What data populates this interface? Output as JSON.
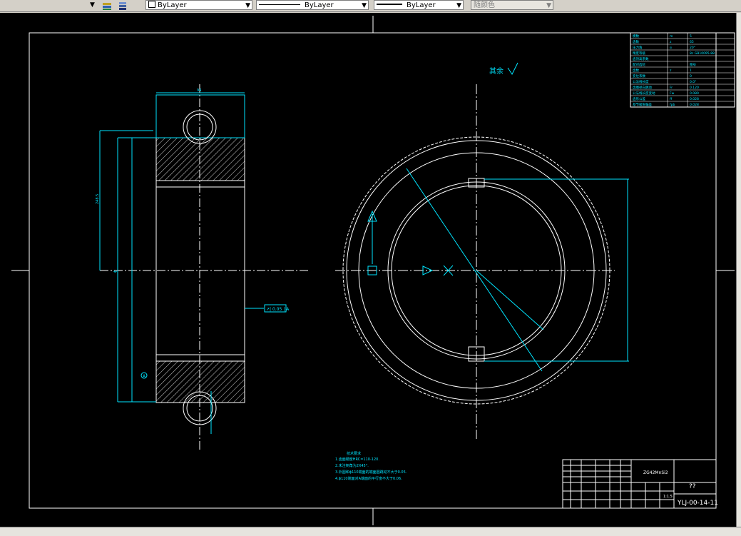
{
  "toolbar": {
    "linetype_value": "ByLayer",
    "lineweight_value": "ByLayer",
    "lineweight2_value": "ByLayer",
    "color_value": "随颜色"
  },
  "drawing": {
    "surface_mark_text": "其余",
    "tech_req_title": "技术要求",
    "tech_req_lines": [
      "1.齿面硬度HRC=110-120.",
      "2.未注倒角为2X45°.",
      "3.外圆和ϕ110端面的端面圆跳动不大于0.05.",
      "4.ϕ110端面对A端面的平行度不大于0.06."
    ],
    "title_material": "ZG42MnSi2",
    "title_name": "??",
    "title_scale": "1:1.5",
    "drawing_number": "YLJ-00-14-11",
    "datum_label": "A",
    "runout_frame": "↗| 0.05 | A",
    "gear_table": [
      [
        "模数",
        "m",
        "5"
      ],
      [
        "齿数",
        "z",
        "65"
      ],
      [
        "压力角",
        "α",
        "20°"
      ],
      [
        "精度等级",
        "",
        "8c GB10095-88"
      ],
      [
        "齿顶高系数",
        "",
        ""
      ],
      [
        "配对齿轮",
        "",
        "图号"
      ],
      [
        "齿数",
        "z",
        "1"
      ],
      [
        "变位系数",
        "",
        "0"
      ],
      [
        "公法线长度",
        "",
        "0.0°"
      ],
      [
        "齿圈径向跳动",
        "Fr",
        "0.120"
      ],
      [
        "公法线长度变动",
        "Fw",
        "0.080"
      ],
      [
        "齿形公差",
        "ff",
        "0.028"
      ],
      [
        "基节极限偏差",
        "fpb",
        "0.028"
      ]
    ]
  },
  "colors": {
    "canvas": "#000000",
    "line": "#ffffff",
    "dim": "#00e5ff",
    "toolbar": "#d4d0c8"
  }
}
